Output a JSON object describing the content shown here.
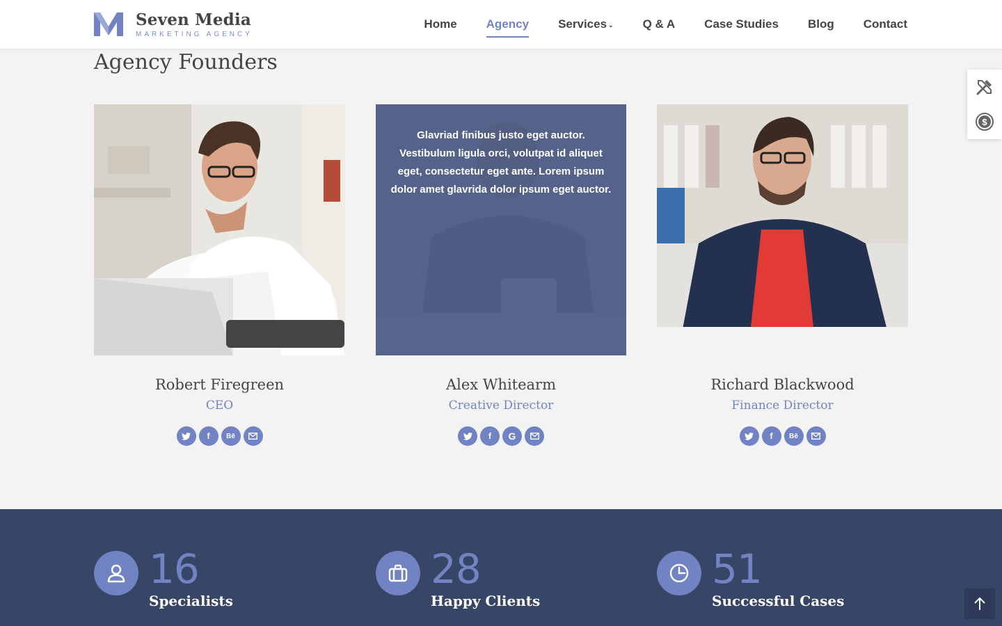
{
  "header": {
    "brand_name": "Seven Media",
    "brand_tagline": "MARKETING AGENCY",
    "nav": [
      {
        "label": "Home"
      },
      {
        "label": "Agency"
      },
      {
        "label": "Services"
      },
      {
        "label": "Q & A"
      },
      {
        "label": "Case Studies"
      },
      {
        "label": "Blog"
      },
      {
        "label": "Contact"
      }
    ],
    "active_nav": "Agency"
  },
  "section": {
    "title": "Agency Founders"
  },
  "team": [
    {
      "name": "Robert Firegreen",
      "role": "CEO",
      "socials": [
        "twitter-icon",
        "facebook-icon",
        "behance-icon",
        "email-icon"
      ]
    },
    {
      "name": "Alex Whitearm",
      "role": "Creative Director",
      "hover_text": "Glavriad finibus justo eget auctor. Vestibulum ligula orci, volutpat id aliquet eget, consectetur eget ante. Lorem ipsum dolor amet glavrida dolor ipsum eget auctor.",
      "socials": [
        "twitter-icon",
        "facebook-icon",
        "google-icon",
        "email-icon"
      ]
    },
    {
      "name": "Richard Blackwood",
      "role": "Finance Director",
      "socials": [
        "twitter-icon",
        "facebook-icon",
        "behance-icon",
        "email-icon"
      ]
    }
  ],
  "stats": [
    {
      "value": "16",
      "label": "Specialists",
      "icon": "user-icon"
    },
    {
      "value": "28",
      "label": "Happy Clients",
      "icon": "briefcase-icon"
    },
    {
      "value": "51",
      "label": "Successful Cases",
      "icon": "pie-chart-icon"
    }
  ],
  "colors": {
    "accent": "#7283c4",
    "dark_band": "#374566",
    "background": "#f3f3f3"
  }
}
